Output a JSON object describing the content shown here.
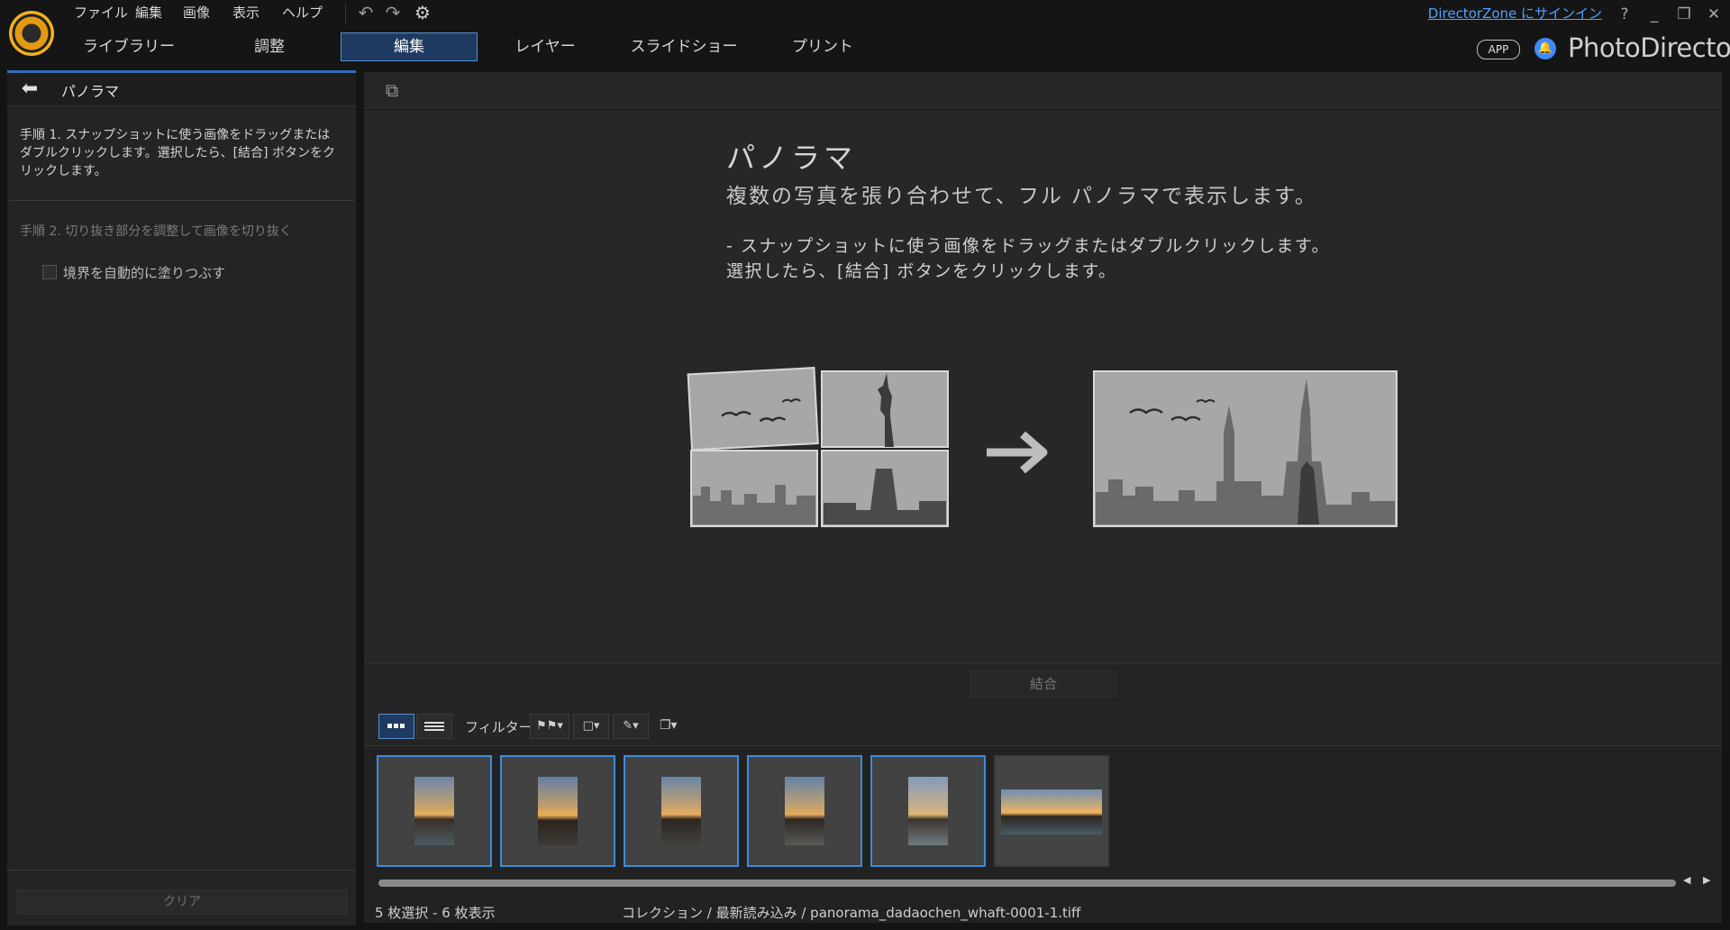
{
  "menu": {
    "file": "ファイル",
    "edit": "編集",
    "image": "画像",
    "view": "表示",
    "help": "ヘルプ"
  },
  "tabs": [
    "ライブラリー",
    "調整",
    "編集",
    "レイヤー",
    "スライドショー",
    "プリント"
  ],
  "active_tab": "編集",
  "account": {
    "signin": "DirectorZone にサインイン"
  },
  "window": {
    "help": "?",
    "minimize": "_",
    "restore": "❐",
    "close": "✕"
  },
  "brand": {
    "app_badge": "APP",
    "name": "PhotoDirector"
  },
  "left_panel": {
    "title": "パノラマ",
    "step1": "手順 1. スナップショットに使う画像をドラッグまたはダブルクリックします。選択したら、[結合] ボタンをクリックします。",
    "step2": "手順 2. 切り抜き部分を調整して画像を切り抜く",
    "autofill_label": "境界を自動的に塗りつぶす",
    "clear_label": "クリア"
  },
  "intro": {
    "title": "パノラマ",
    "subtitle": "複数の写真を張り合わせて、フル パノラマで表示します。",
    "desc_line1": "- スナップショットに使う画像をドラッグまたはダブルクリックします。",
    "desc_line2": "選択したら、[結合] ボタンをクリックします。"
  },
  "combine_label": "結合",
  "filter_label": "フィルター:",
  "thumbnails": [
    {
      "selected": true,
      "kind": "portrait"
    },
    {
      "selected": true,
      "kind": "portrait"
    },
    {
      "selected": true,
      "kind": "portrait"
    },
    {
      "selected": true,
      "kind": "portrait"
    },
    {
      "selected": true,
      "kind": "portrait"
    },
    {
      "selected": false,
      "kind": "panorama"
    }
  ],
  "status": {
    "count": "5 枚選択 - 6 枚表示",
    "path": "コレクション / 最新読み込み / panorama_dadaochen_whaft-0001-1.tiff"
  },
  "colors": {
    "accent": "#3d8bdc",
    "active_tab_bg": "#1f3a60",
    "link": "#4fa3ff",
    "logo": "#e29a13"
  }
}
